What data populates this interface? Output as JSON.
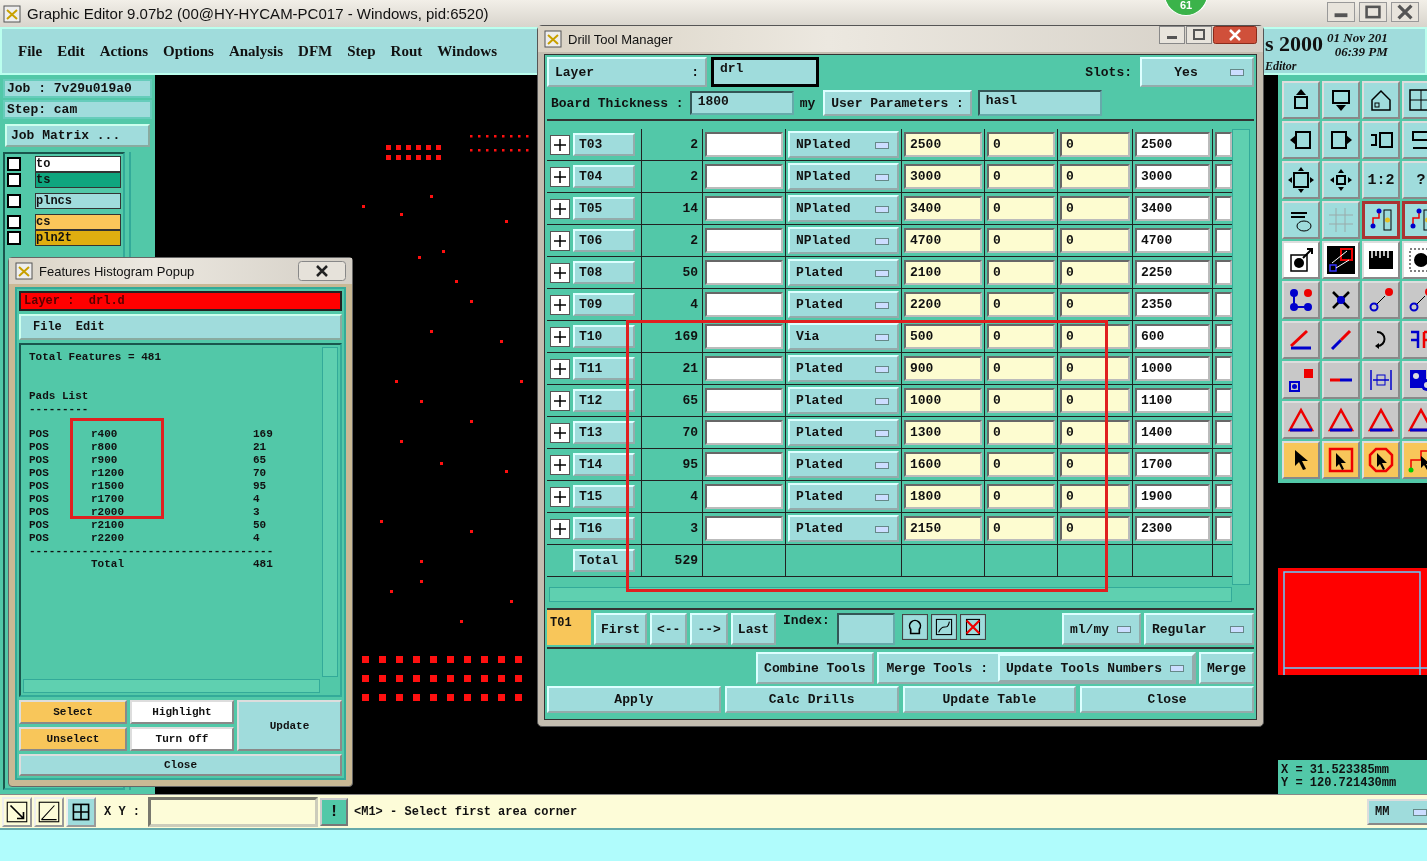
{
  "window": {
    "title": "Graphic Editor 9.07b2 (00@HY-HYCAM-PC017 - Windows, pid:6520)"
  },
  "notification_badge": "61",
  "menu": [
    "File",
    "Edit",
    "Actions",
    "Options",
    "Analysis",
    "DFM",
    "Step",
    "Rout",
    "Windows"
  ],
  "header": {
    "product": "s 2000",
    "date": "01 Nov 201",
    "time": "06:39 PM",
    "subtitle": "Editor"
  },
  "job": {
    "job": "Job : 7v29u019a0",
    "step": "Step: cam",
    "matrix_button": "Job Matrix ..."
  },
  "layers": [
    {
      "name": "to",
      "color": "#ffffff",
      "checked": false
    },
    {
      "name": "ts",
      "color": "#0fa57e",
      "checked": false
    },
    {
      "name": "plncs",
      "color": "#a0dcdc",
      "checked": false
    },
    {
      "name": "cs",
      "color": "#fac75a",
      "checked": false
    },
    {
      "name": "pln2t",
      "color": "#e0ae10",
      "checked": false
    }
  ],
  "toolbar_texts": [
    "1:2",
    "?"
  ],
  "features_popup": {
    "title": "Features Histogram Popup",
    "layer": "Layer :  drl.d",
    "menu": [
      "File",
      "Edit"
    ],
    "total_features": "Total Features = 481",
    "list_title": "Pads List",
    "list_underline": "---------",
    "rows": [
      {
        "polarity": "POS",
        "symbol": "r400",
        "count": "169"
      },
      {
        "polarity": "POS",
        "symbol": "r800",
        "count": "21"
      },
      {
        "polarity": "POS",
        "symbol": "r900",
        "count": "65"
      },
      {
        "polarity": "POS",
        "symbol": "r1200",
        "count": "70"
      },
      {
        "polarity": "POS",
        "symbol": "r1500",
        "count": "95"
      },
      {
        "polarity": "POS",
        "symbol": "r1700",
        "count": "4"
      },
      {
        "polarity": "POS",
        "symbol": "r2000",
        "count": "3"
      },
      {
        "polarity": "POS",
        "symbol": "r2100",
        "count": "50"
      },
      {
        "polarity": "POS",
        "symbol": "r2200",
        "count": "4"
      }
    ],
    "rule": "-------------------------------------",
    "total_label": "Total",
    "total": "481",
    "buttons": [
      {
        "label": "Select",
        "kind": "action"
      },
      {
        "label": "Highlight",
        "kind": "toggle"
      },
      {
        "label": "Unselect",
        "kind": "action"
      },
      {
        "label": "Turn Off",
        "kind": "toggle"
      }
    ],
    "update_button": "Update",
    "close_button": "Close"
  },
  "drill_tool_manager": {
    "title": "Drill Tool Manager",
    "layer_label": "Layer",
    "layer_colon": ":",
    "layer": "drl",
    "slots_label": "Slots:",
    "slots": "Yes",
    "thickness_label": "Board Thickness :",
    "thickness": "1800",
    "thickness_unit": "my",
    "user_params_label": "User Parameters :",
    "user_params": "hasl",
    "rows": [
      {
        "tool": "T03",
        "count": "2",
        "type": "NPlated",
        "column_5": "2500",
        "column_6": "0",
        "column_7": "0",
        "column_8": "2500"
      },
      {
        "tool": "T04",
        "count": "2",
        "type": "NPlated",
        "column_5": "3000",
        "column_6": "0",
        "column_7": "0",
        "column_8": "3000"
      },
      {
        "tool": "T05",
        "count": "14",
        "type": "NPlated",
        "column_5": "3400",
        "column_6": "0",
        "column_7": "0",
        "column_8": "3400"
      },
      {
        "tool": "T06",
        "count": "2",
        "type": "NPlated",
        "column_5": "4700",
        "column_6": "0",
        "column_7": "0",
        "column_8": "4700"
      },
      {
        "tool": "T08",
        "count": "50",
        "type": "Plated",
        "column_5": "2100",
        "column_6": "0",
        "column_7": "0",
        "column_8": "2250"
      },
      {
        "tool": "T09",
        "count": "4",
        "type": "Plated",
        "column_5": "2200",
        "column_6": "0",
        "column_7": "0",
        "column_8": "2350"
      },
      {
        "tool": "T10",
        "count": "169",
        "type": "Via",
        "column_5": "500",
        "column_6": "0",
        "column_7": "0",
        "column_8": "600"
      },
      {
        "tool": "T11",
        "count": "21",
        "type": "Plated",
        "column_5": "900",
        "column_6": "0",
        "column_7": "0",
        "column_8": "1000"
      },
      {
        "tool": "T12",
        "count": "65",
        "type": "Plated",
        "column_5": "1000",
        "column_6": "0",
        "column_7": "0",
        "column_8": "1100"
      },
      {
        "tool": "T13",
        "count": "70",
        "type": "Plated",
        "column_5": "1300",
        "column_6": "0",
        "column_7": "0",
        "column_8": "1400"
      },
      {
        "tool": "T14",
        "count": "95",
        "type": "Plated",
        "column_5": "1600",
        "column_6": "0",
        "column_7": "0",
        "column_8": "1700"
      },
      {
        "tool": "T15",
        "count": "4",
        "type": "Plated",
        "column_5": "1800",
        "column_6": "0",
        "column_7": "0",
        "column_8": "1900"
      },
      {
        "tool": "T16",
        "count": "3",
        "type": "Plated",
        "column_5": "2150",
        "column_6": "0",
        "column_7": "0",
        "column_8": "2300"
      }
    ],
    "total_label": "Total",
    "total": "529",
    "current_tool": "T01",
    "nav_buttons": [
      "First",
      "<--",
      "-->",
      "Last"
    ],
    "index_label": "Index:",
    "units": "ml/my",
    "mode": "Regular",
    "combine_button": "Combine Tools",
    "merge_label": "Merge Tools :",
    "merge_option": "Update Tools Numbers",
    "merge_button": "Merge",
    "buttons": [
      "Apply",
      "Calc Drills",
      "Update Table",
      "Close"
    ]
  },
  "coordinates": [
    "X = 31.523385mm",
    "Y = 120.721430mm"
  ],
  "status_bar": {
    "xy_label": "X Y :",
    "alert": "!",
    "message": "<M1> - Select first area corner",
    "units": "MM"
  }
}
